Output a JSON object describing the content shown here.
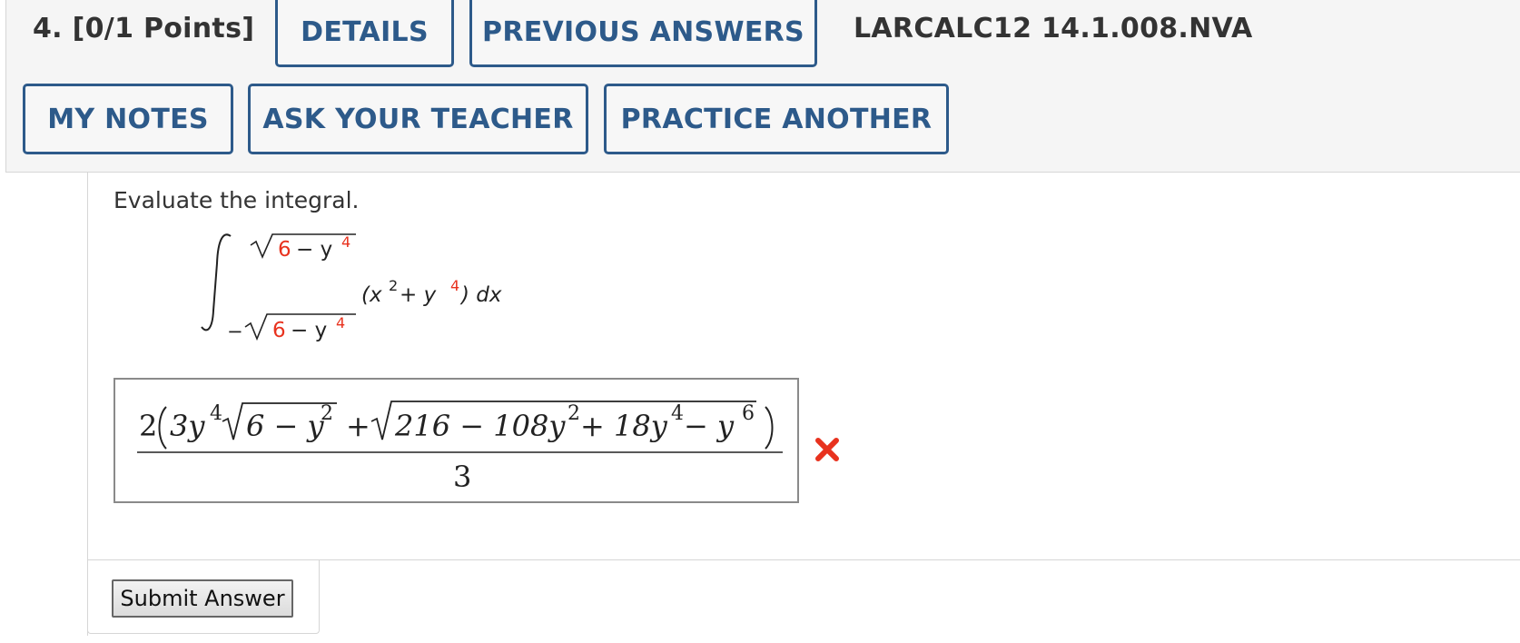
{
  "question": {
    "number_label": "4.",
    "points_label": "[0/1 Points]",
    "assignment_code": "LARCALC12 14.1.008.NVA"
  },
  "buttons": {
    "details": "DETAILS",
    "previous_answers": "PREVIOUS ANSWERS",
    "my_notes": "MY NOTES",
    "ask_teacher": "ASK YOUR TEACHER",
    "practice_another": "PRACTICE ANOTHER",
    "submit": "Submit Answer"
  },
  "prompt": "Evaluate the integral.",
  "integral": {
    "upper_const": "6",
    "upper_rest": "− y",
    "upper_exp": "4",
    "lower_sign": "−",
    "lower_const": "6",
    "lower_rest": "− y",
    "lower_exp": "4",
    "integrand_open": "(x",
    "integrand_exp1": "2",
    "integrand_mid": " + y",
    "integrand_exp2": "4",
    "integrand_close": ") dx"
  },
  "answer": {
    "n_coeff": "2",
    "n_term1": "3y",
    "n_term1_exp": "4",
    "n_rad1": "6 − y",
    "n_rad1_exp": "2",
    "n_plus": "+",
    "n_rad2_a": "216 − 108y",
    "n_rad2_a_exp": "2",
    "n_rad2_b": " + 18y",
    "n_rad2_b_exp": "4",
    "n_rad2_c": " − y",
    "n_rad2_c_exp": "6",
    "denominator": "3",
    "status": "incorrect"
  },
  "colors": {
    "button_accent": "#2d5a8a",
    "wrong_mark": "#e8321e",
    "highlight_value": "#e8321e"
  },
  "icons": {
    "wrong_mark": "x-mark-icon"
  }
}
